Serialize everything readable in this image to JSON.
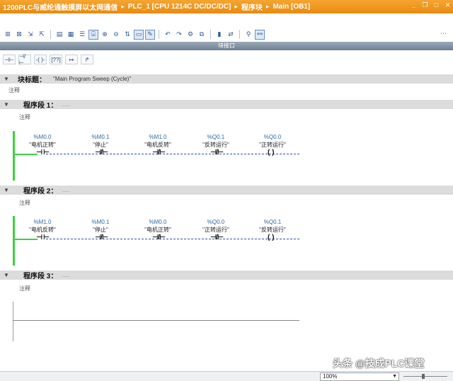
{
  "title": {
    "project": "1200PLC与威纶通触摸屏以太网通信",
    "device": "PLC_1 [CPU 1214C DC/DC/DC]",
    "folder": "程序块",
    "block": "Main [OB1]",
    "separator": "▸"
  },
  "favorites_strip": "块接口",
  "block_title": {
    "label": "块标题：",
    "text": "\"Main Program Sweep (Cycle)\"",
    "comment": "注释"
  },
  "networks": [
    {
      "label": "程序段 1：",
      "dots": ".....",
      "comment": "注释",
      "elements": [
        {
          "addr": "%M0.0",
          "sym": "\"电机正转\"",
          "kind": "NO"
        },
        {
          "addr": "%M0.1",
          "sym": "\"停止\"",
          "kind": "NC"
        },
        {
          "addr": "%M1.0",
          "sym": "\"电机反转\"",
          "kind": "NC"
        },
        {
          "addr": "%Q0.1",
          "sym": "\"反转运行\"",
          "kind": "NC"
        },
        {
          "addr": "%Q0.0",
          "sym": "\"正转运行\"",
          "kind": "COIL"
        }
      ]
    },
    {
      "label": "程序段 2：",
      "dots": ".....",
      "comment": "注释",
      "elements": [
        {
          "addr": "%M1.0",
          "sym": "\"电机反转\"",
          "kind": "NO"
        },
        {
          "addr": "%M0.1",
          "sym": "\"停止\"",
          "kind": "NC"
        },
        {
          "addr": "%M0.0",
          "sym": "\"电机正转\"",
          "kind": "NC"
        },
        {
          "addr": "%Q0.0",
          "sym": "\"正转运行\"",
          "kind": "NC"
        },
        {
          "addr": "%Q0.1",
          "sym": "\"反转运行\"",
          "kind": "COIL"
        }
      ]
    },
    {
      "label": "程序段 3：",
      "dots": ".....",
      "comment": "注释",
      "elements": []
    }
  ],
  "ladder_tools": [
    "⊣⊢",
    "⊣/⊢",
    "-( )-",
    "[??]",
    "↦",
    "↱"
  ],
  "status": {
    "zoom": "100%"
  },
  "watermark": "头条 @技成PLC课堂",
  "colors": {
    "titlebar": "#f0961c",
    "power_rail": "#3ed13e",
    "wire": "#2b4fa8",
    "address": "#2a6aa8",
    "section_header": "#dcdcdc"
  }
}
